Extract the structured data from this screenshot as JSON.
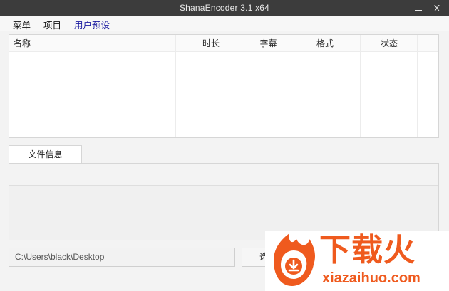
{
  "window": {
    "title": "ShanaEncoder 3.1 x64",
    "close_label": "X"
  },
  "menu": {
    "items": [
      {
        "label": "菜单"
      },
      {
        "label": "项目"
      },
      {
        "label": "用户预设"
      }
    ]
  },
  "table": {
    "columns": [
      {
        "label": "名称"
      },
      {
        "label": "时长"
      },
      {
        "label": "字幕"
      },
      {
        "label": "格式"
      },
      {
        "label": "状态"
      }
    ],
    "rows": []
  },
  "info_tabs": [
    {
      "label": "文件信息",
      "selected": true
    }
  ],
  "output": {
    "path": "C:\\Users\\black\\Desktop",
    "select_button_label": "选"
  },
  "watermark": {
    "text": "下载火",
    "url": "xiazaihuo.com"
  },
  "colors": {
    "titlebar": "#3c3c3c",
    "active_menu": "#1a1aa0",
    "watermark": "#ef5a1e"
  }
}
